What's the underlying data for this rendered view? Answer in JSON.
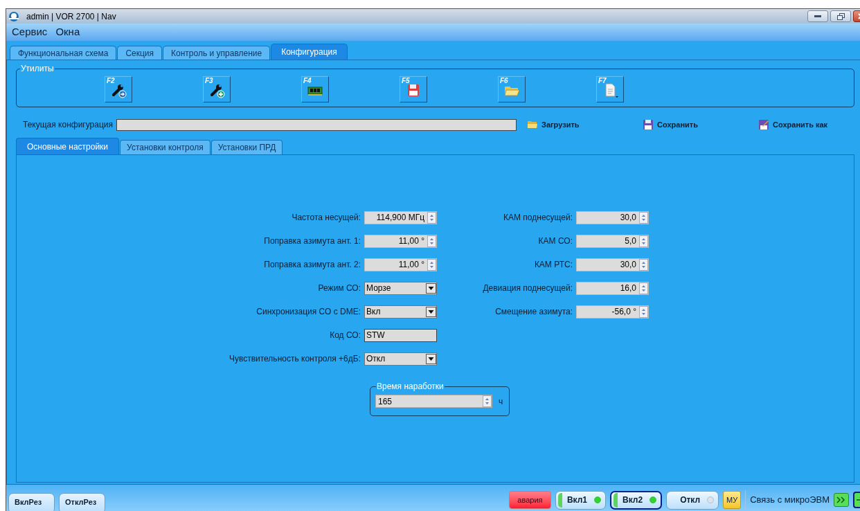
{
  "window": {
    "title": "admin | VOR 2700 | Nav"
  },
  "menu": [
    "Сервис",
    "Окна"
  ],
  "tabs": [
    {
      "label": "Функциональная схема",
      "selected": false
    },
    {
      "label": "Секция",
      "selected": false
    },
    {
      "label": "Контроль и управление",
      "selected": false
    },
    {
      "label": "Конфигурация",
      "selected": true
    }
  ],
  "utilities": {
    "title": "Утилиты",
    "buttons": [
      {
        "key": "F2",
        "kind": "wrench-arrow"
      },
      {
        "key": "F3",
        "kind": "wrench-plus"
      },
      {
        "key": "F4",
        "kind": "memory"
      },
      {
        "key": "F5",
        "kind": "save"
      },
      {
        "key": "F6",
        "kind": "folder"
      },
      {
        "key": "F7",
        "kind": "document-menu"
      }
    ]
  },
  "current_config": {
    "label": "Текущая конфигурация"
  },
  "config_actions": [
    {
      "label": "Загрузить",
      "kind": "load"
    },
    {
      "label": "Сохранить",
      "kind": "save"
    },
    {
      "label": "Сохранить как",
      "kind": "save-as"
    }
  ],
  "settings_tabs": [
    {
      "label": "Основные настройки",
      "selected": true
    },
    {
      "label": "Установки контроля",
      "selected": false
    },
    {
      "label": "Установки ПРД",
      "selected": false
    }
  ],
  "left_fields": [
    {
      "label": "Частота несущей:",
      "kind": "spin",
      "value": "114,900 МГц"
    },
    {
      "label": "Поправка азимута ант. 1:",
      "kind": "spin",
      "value": "11,00 °"
    },
    {
      "label": "Поправка азимута ант. 2:",
      "kind": "spin",
      "value": "11,00 °"
    },
    {
      "label": "Режим СО:",
      "kind": "combo",
      "value": "Морзе"
    },
    {
      "label": "Синхронизация СО с DME:",
      "kind": "combo",
      "value": "Вкл"
    },
    {
      "label": "Код СО:",
      "kind": "text",
      "value": "STW"
    },
    {
      "label": "Чувствительность контроля +6дБ:",
      "kind": "combo",
      "value": "Откл"
    }
  ],
  "right_fields": [
    {
      "label": "КАМ поднесущей:",
      "kind": "spin",
      "value": "30,0"
    },
    {
      "label": "КАМ СО:",
      "kind": "spin",
      "value": "5,0"
    },
    {
      "label": "КАМ РТС:",
      "kind": "spin",
      "value": "30,0"
    },
    {
      "label": "Девиация поднесущей:",
      "kind": "spin",
      "value": "16,0"
    },
    {
      "label": "Смещение азимута:",
      "kind": "spin",
      "value": "-56,0 °"
    }
  ],
  "runtime": {
    "title": "Время наработки",
    "value": "165",
    "unit": "ч"
  },
  "bottom_left_buttons": [
    "ВклРез",
    "ОтклРез"
  ],
  "alarm": "авария",
  "modes": [
    {
      "label": "Вкл1",
      "led_on": true,
      "selected": false
    },
    {
      "label": "Вкл2",
      "led_on": true,
      "selected": true
    },
    {
      "label": "Откл",
      "led_on": false,
      "selected": false
    }
  ],
  "local_mode": "МУ",
  "link": {
    "label": "Связь с микроЭВМ"
  }
}
